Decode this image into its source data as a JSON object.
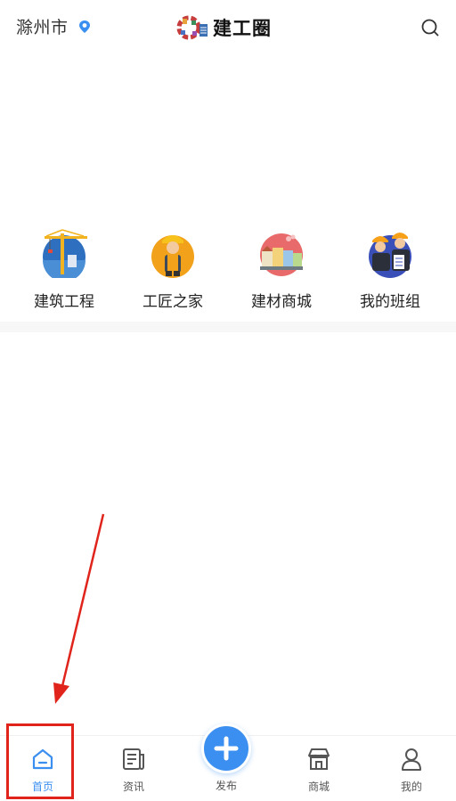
{
  "header": {
    "city": "滁州市",
    "logo_text": "建工圈"
  },
  "categories": [
    {
      "label": "建筑工程",
      "icon": "crane-icon"
    },
    {
      "label": "工匠之家",
      "icon": "worker-icon"
    },
    {
      "label": "建材商城",
      "icon": "building-materials-icon"
    },
    {
      "label": "我的班组",
      "icon": "team-icon"
    }
  ],
  "tabbar": {
    "items": [
      {
        "label": "首页",
        "icon": "home-icon",
        "active": true
      },
      {
        "label": "资讯",
        "icon": "news-icon",
        "active": false
      },
      {
        "label": "发布",
        "icon": "plus-icon",
        "active": false
      },
      {
        "label": "商城",
        "icon": "store-icon",
        "active": false
      },
      {
        "label": "我的",
        "icon": "user-icon",
        "active": false
      }
    ],
    "active_color": "#3b8ff1"
  },
  "colors": {
    "accent": "#3b8ff1",
    "annotation": "#e0241b"
  }
}
